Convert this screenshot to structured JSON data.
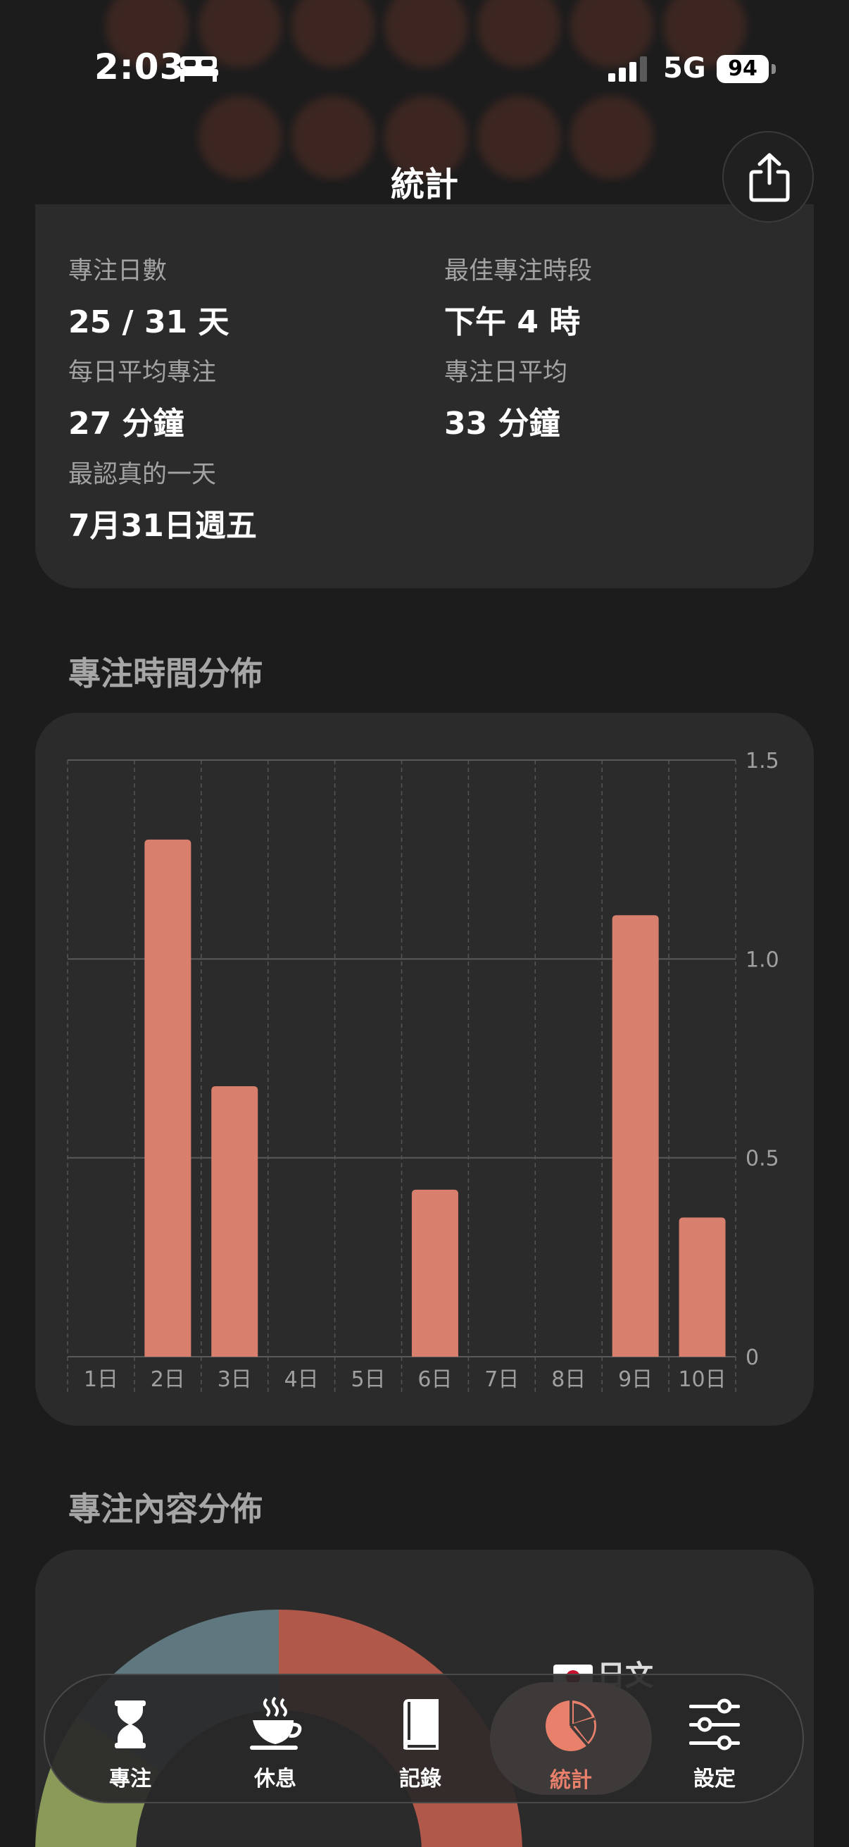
{
  "status_bar": {
    "time": "2:03",
    "network": "5G",
    "battery": "94"
  },
  "header": {
    "title": "統計"
  },
  "summary": {
    "focus_days_label": "專注日數",
    "focus_days_value": "25 / 31 天",
    "best_period_label": "最佳專注時段",
    "best_period_value": "下午 4 時",
    "daily_avg_label": "每日平均專注",
    "daily_avg_value": "27 分鐘",
    "focus_day_avg_label": "專注日平均",
    "focus_day_avg_value": "33 分鐘",
    "best_day_label": "最認真的一天",
    "best_day_value": "7月31日週五"
  },
  "sections": {
    "time_distribution": "專注時間分佈",
    "content_distribution": "專注內容分佈"
  },
  "chart_data": {
    "type": "bar",
    "categories": [
      "1日",
      "2日",
      "3日",
      "4日",
      "5日",
      "6日",
      "7日",
      "8日",
      "9日",
      "10日"
    ],
    "values": [
      0,
      1.3,
      0.68,
      0,
      0,
      0.42,
      0,
      0,
      1.11,
      0.35
    ],
    "yticks": [
      "0",
      "0.5",
      "1.0",
      "1.5"
    ],
    "ylim": [
      0,
      1.5
    ],
    "bar_color": "#d97f6e",
    "grid": true
  },
  "pie_partial": {
    "legend_first": "日文"
  },
  "tabs": [
    {
      "label": "專注",
      "icon": "hourglass-icon"
    },
    {
      "label": "休息",
      "icon": "coffee-cup-icon"
    },
    {
      "label": "記錄",
      "icon": "book-icon"
    },
    {
      "label": "統計",
      "icon": "pie-chart-icon"
    },
    {
      "label": "設定",
      "icon": "sliders-icon"
    }
  ],
  "colors": {
    "accent": "#e8806c",
    "bar": "#d97f6e",
    "card": "#2b2b2b",
    "background": "#1c1c1c"
  }
}
